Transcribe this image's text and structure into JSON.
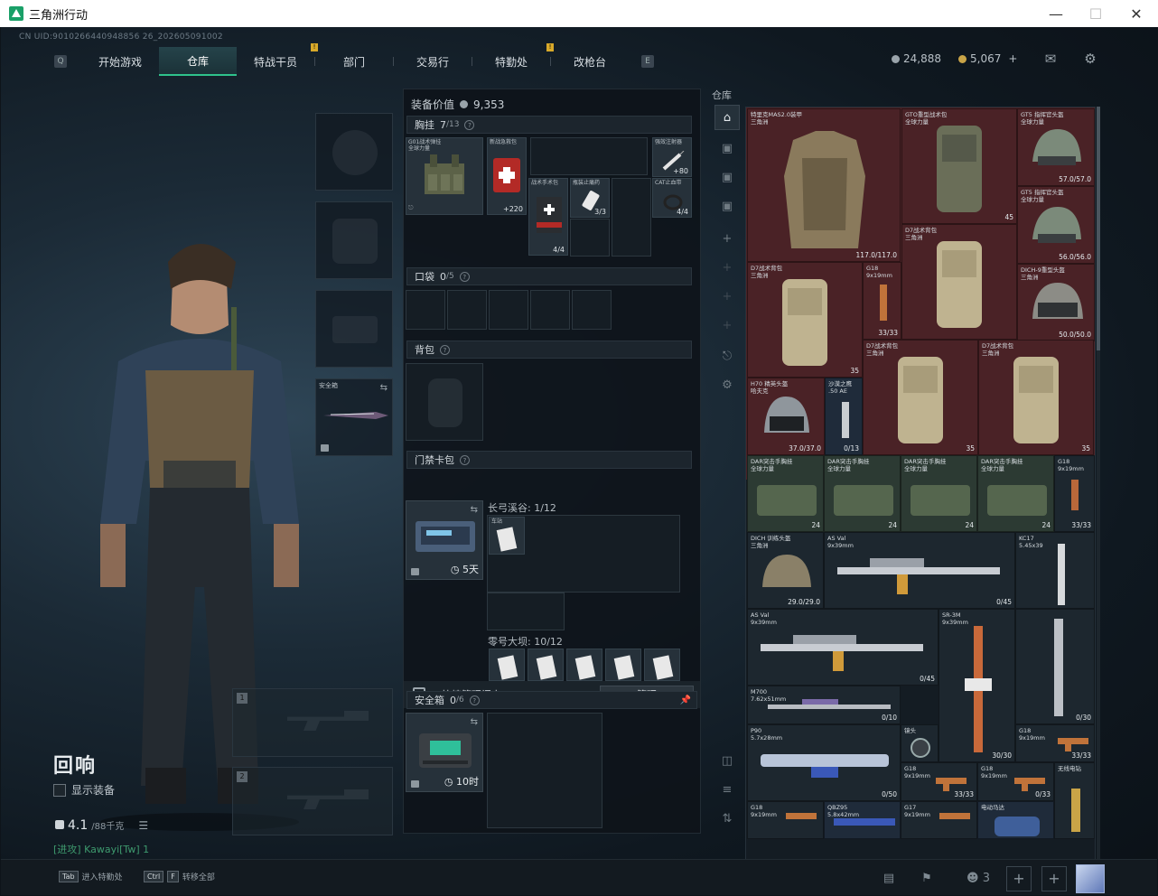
{
  "window": {
    "title": "三角洲行动"
  },
  "uid": "CN UID:9010266440948856 26_202605091002",
  "nav": {
    "tabs": [
      "开始游戏",
      "仓库",
      "特战干员",
      "部门",
      "交易行",
      "特勤处",
      "改枪台"
    ],
    "active": "仓库"
  },
  "currency": {
    "silver": "24,888",
    "gold": "5,067",
    "plus": "+"
  },
  "operator": {
    "name": "回响",
    "show_equipment": "显示装备",
    "weight": "4.1",
    "weight_max": "/88千克",
    "player_tag": "[进攻] Kawayi[Tw] 1"
  },
  "slots": {
    "secure_label": "安全箱",
    "weapon1": "1",
    "weapon2": "2"
  },
  "middle": {
    "equip_value_label": "装备价值",
    "equip_value": "9,353",
    "chest_rig": "胸挂",
    "chest_rig_count": "7",
    "chest_rig_total": "/13",
    "pocket": "口袋",
    "pocket_count": "0",
    "pocket_total": "/5",
    "backpack": "背包",
    "card_pack": "门禁卡包",
    "card_days": "5天",
    "valley": "长弓溪谷: 1/12",
    "dam": "零号大坝: 10/12",
    "quick_manage": "快捷管理门卡",
    "manage": "管理",
    "safe_box": "安全箱",
    "safe_count": "0",
    "safe_total": "/6",
    "safe_hours": "10时",
    "items": {
      "rig_name": "G01战术弹挂\n全球力量",
      "medkit_name": "新战急救包",
      "medkit_count": "+220",
      "tourniquet_name": "战术手术包",
      "tourniquet_count": "4/4",
      "bandage_name": "瓶装止痛药",
      "bandage_count": "3/3",
      "injector_name": "强效注射器",
      "injector_count": "+80",
      "cat_name": "CAT止血带",
      "cat_count": "4/4",
      "card_name": "车站"
    }
  },
  "stash": {
    "label": "仓库",
    "items": [
      {
        "name": "特里克MAS2.0装甲\n三角洲",
        "value": "117.0/117.0"
      },
      {
        "name": "GTO重型战术包\n全球力量",
        "value": "45"
      },
      {
        "name": "GT5 指挥官头盔\n全球力量",
        "value": "57.0/57.0"
      },
      {
        "name": "GT5 指挥官头盔\n全球力量",
        "value": "56.0/56.0"
      },
      {
        "name": "D7战术背包\n三角洲",
        "value": "35"
      },
      {
        "name": "D7战术背包\n三角洲",
        "value": ""
      },
      {
        "name": "G18\n9x19mm",
        "value": "33/33"
      },
      {
        "name": "DICH-9重型头盔\n三角洲",
        "value": "50.0/50.0"
      },
      {
        "name": "D7战术背包\n三角洲",
        "value": "35"
      },
      {
        "name": "D7战术背包\n三角洲",
        "value": "35"
      },
      {
        "name": "H70 精英头盔\n哈夫克",
        "value": "37.0/37.0"
      },
      {
        "name": "沙漠之鹰\n.50 AE",
        "value": "0/13"
      },
      {
        "name": "DAR突击手胸挂\n全球力量",
        "value": "24"
      },
      {
        "name": "DAR突击手胸挂\n全球力量",
        "value": "24"
      },
      {
        "name": "DAR突击手胸挂\n全球力量",
        "value": "24"
      },
      {
        "name": "DAR突击手胸挂\n全球力量",
        "value": "24"
      },
      {
        "name": "G18\n9x19mm",
        "value": "33/33"
      },
      {
        "name": "DICH 训练头盔\n三角洲",
        "value": "29.0/29.0"
      },
      {
        "name": "AS Val\n9x39mm",
        "value": "0/45"
      },
      {
        "name": "KC17\n5.45x39",
        "value": ""
      },
      {
        "name": "AS Val\n9x39mm",
        "value": "0/45"
      },
      {
        "name": "SR-3M\n9x39mm",
        "value": ""
      },
      {
        "name": "",
        "value": "0/30"
      },
      {
        "name": "M700\n7.62x51mm",
        "value": "0/10"
      },
      {
        "name": "",
        "value": "30/30"
      },
      {
        "name": "P90\n5.7x28mm",
        "value": "0/50"
      },
      {
        "name": "镜头",
        "value": ""
      },
      {
        "name": "G18\n9x19mm",
        "value": "33/33"
      },
      {
        "name": "G18\n9x19mm",
        "value": "33/33"
      },
      {
        "name": "G18\n9x19mm",
        "value": "0/33"
      },
      {
        "name": "无线电钻",
        "value": ""
      },
      {
        "name": "G18\n9x19mm",
        "value": ""
      },
      {
        "name": "QBZ95\n5.8x42mm",
        "value": ""
      },
      {
        "name": "G17\n9x19mm",
        "value": ""
      },
      {
        "name": "电动马达",
        "value": ""
      }
    ]
  },
  "bottom": {
    "tab_key": "Tab",
    "tab_hint": "进入特勤处",
    "ctrl_key": "Ctrl",
    "f_key": "F",
    "ctrl_hint": "转移全部",
    "friends": "3"
  },
  "colors": {
    "accent": "#2fc28c",
    "stash_red": "#4a2226",
    "stash_green": "#2c3a33",
    "stash_blue": "#1f2b3a"
  }
}
